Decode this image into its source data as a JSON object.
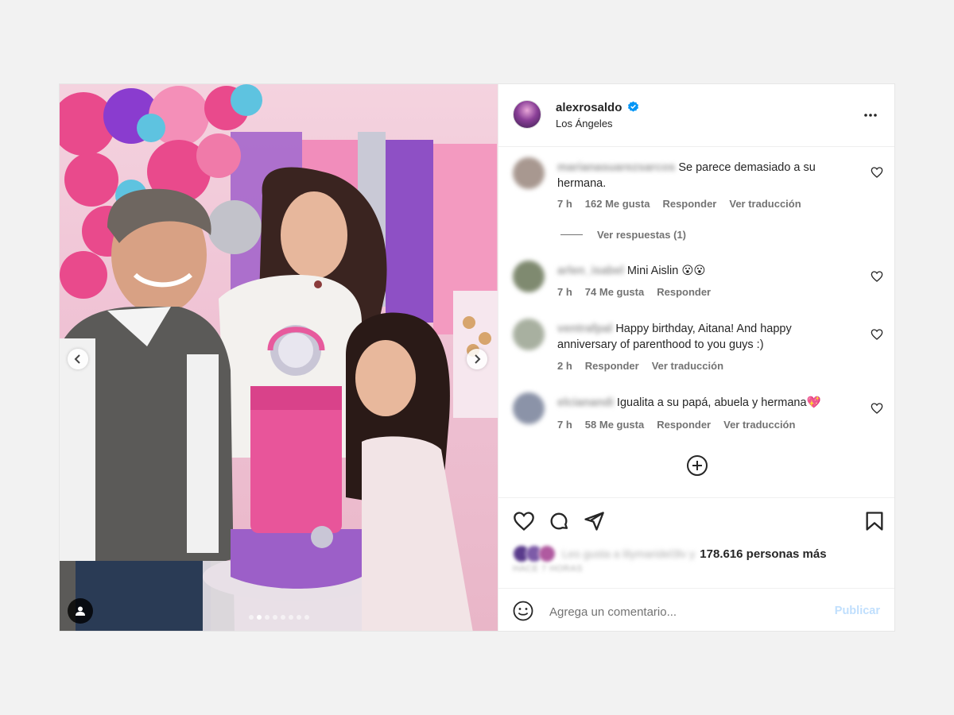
{
  "post": {
    "username": "alexrosaldo",
    "location": "Los Ángeles",
    "photo_alt": "",
    "carousel": {
      "total": 8,
      "active": 1
    }
  },
  "comments": [
    {
      "user": "marianasuarezsarcos",
      "text": "Se parece demasiado a su hermana.",
      "time": "7 h",
      "likes": "162 Me gusta",
      "reply": "Responder",
      "translate": "Ver traducción",
      "avatar_color": "#a89890"
    },
    {
      "user": "arlen_isabel",
      "text": "Mini Aislin 😮😮",
      "time": "7 h",
      "likes": "74 Me gusta",
      "reply": "Responder",
      "avatar_color": "#7f8a70"
    },
    {
      "user": "ventrafpal",
      "text": "Happy birthday, Aitana! And happy anniversary of parenthood to you guys :)",
      "time": "2 h",
      "reply": "Responder",
      "translate": "Ver traducción",
      "avatar_color": "#a8b0a0"
    },
    {
      "user": "elcianandi",
      "text": "Igualita a su papá, abuela y hermana💖",
      "time": "7 h",
      "likes": "58 Me gusta",
      "reply": "Responder",
      "translate": "Ver traducción",
      "avatar_color": "#8b93a8"
    }
  ],
  "replies_link": "Ver respuestas (1)",
  "likes": {
    "blurred_text": "Les gusta a lilymaridel3lv y",
    "count": "178.616 personas más",
    "avatar_colors": [
      "#5a3b8c",
      "#7d5ba8",
      "#b05aa0"
    ]
  },
  "date_blurred": "HACE 7 HORAS",
  "composer": {
    "placeholder": "Agrega un comentario...",
    "publish": "Publicar"
  },
  "colors": {
    "verified": "#0095f6",
    "publish_disabled": "#c0dffd",
    "meta": "#737373"
  },
  "icons": [
    "verified-badge-icon",
    "more-options-icon",
    "heart-icon",
    "comment-icon",
    "share-icon",
    "bookmark-icon",
    "plus-circle-icon",
    "emoji-icon",
    "chevron-left-icon",
    "chevron-right-icon",
    "user-tag-icon"
  ]
}
